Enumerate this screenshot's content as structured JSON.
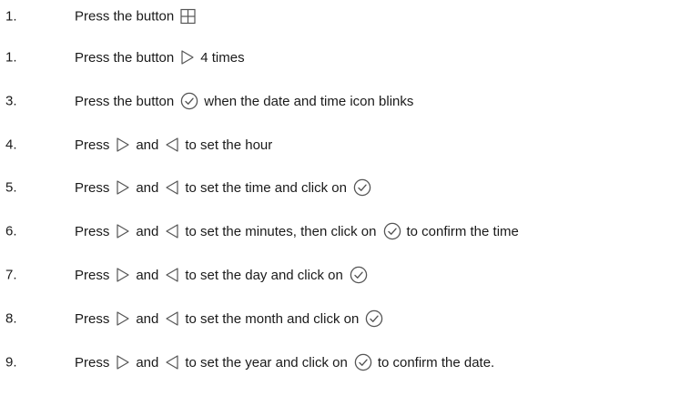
{
  "steps": [
    {
      "number": "1.",
      "parts": [
        {
          "type": "text",
          "value": "Press the button"
        },
        {
          "type": "icon",
          "icon": "grid-icon"
        }
      ]
    },
    {
      "number": "1.",
      "parts": [
        {
          "type": "text",
          "value": "Press the button"
        },
        {
          "type": "icon",
          "icon": "right-arrow-icon"
        },
        {
          "type": "text",
          "value": "4 times"
        }
      ]
    },
    {
      "number": "3.",
      "parts": [
        {
          "type": "text",
          "value": "Press the button"
        },
        {
          "type": "icon",
          "icon": "check-circle-icon"
        },
        {
          "type": "text",
          "value": "when the date and time icon blinks"
        }
      ]
    },
    {
      "number": "4.",
      "parts": [
        {
          "type": "text",
          "value": "Press"
        },
        {
          "type": "icon",
          "icon": "right-arrow-icon"
        },
        {
          "type": "text",
          "value": "and"
        },
        {
          "type": "icon",
          "icon": "left-arrow-icon"
        },
        {
          "type": "text",
          "value": "to set the hour"
        }
      ]
    },
    {
      "number": "5.",
      "parts": [
        {
          "type": "text",
          "value": "Press"
        },
        {
          "type": "icon",
          "icon": "right-arrow-icon"
        },
        {
          "type": "text",
          "value": "and"
        },
        {
          "type": "icon",
          "icon": "left-arrow-icon"
        },
        {
          "type": "text",
          "value": "to set the time and click on"
        },
        {
          "type": "icon",
          "icon": "check-circle-icon"
        }
      ]
    },
    {
      "number": "6.",
      "parts": [
        {
          "type": "text",
          "value": "Press"
        },
        {
          "type": "icon",
          "icon": "right-arrow-icon"
        },
        {
          "type": "text",
          "value": "and"
        },
        {
          "type": "icon",
          "icon": "left-arrow-icon"
        },
        {
          "type": "text",
          "value": "to set the minutes, then click on"
        },
        {
          "type": "icon",
          "icon": "check-circle-icon"
        },
        {
          "type": "text",
          "value": "to confirm the time"
        }
      ]
    },
    {
      "number": "7.",
      "parts": [
        {
          "type": "text",
          "value": "Press"
        },
        {
          "type": "icon",
          "icon": "right-arrow-icon"
        },
        {
          "type": "text",
          "value": "and"
        },
        {
          "type": "icon",
          "icon": "left-arrow-icon"
        },
        {
          "type": "text",
          "value": "to set the day  and click on"
        },
        {
          "type": "icon",
          "icon": "check-circle-icon"
        }
      ]
    },
    {
      "number": "8.",
      "parts": [
        {
          "type": "text",
          "value": "Press"
        },
        {
          "type": "icon",
          "icon": "right-arrow-icon"
        },
        {
          "type": "text",
          "value": "and"
        },
        {
          "type": "icon",
          "icon": "left-arrow-icon"
        },
        {
          "type": "text",
          "value": "to set the month and click on"
        },
        {
          "type": "icon",
          "icon": "check-circle-icon"
        }
      ]
    },
    {
      "number": "9.",
      "parts": [
        {
          "type": "text",
          "value": "Press"
        },
        {
          "type": "icon",
          "icon": "right-arrow-icon"
        },
        {
          "type": "text",
          "value": "and"
        },
        {
          "type": "icon",
          "icon": "left-arrow-icon"
        },
        {
          "type": "text",
          "value": "to set the year and click on"
        },
        {
          "type": "icon",
          "icon": "check-circle-icon"
        },
        {
          "type": "text",
          "value": "to confirm the date."
        }
      ]
    }
  ]
}
